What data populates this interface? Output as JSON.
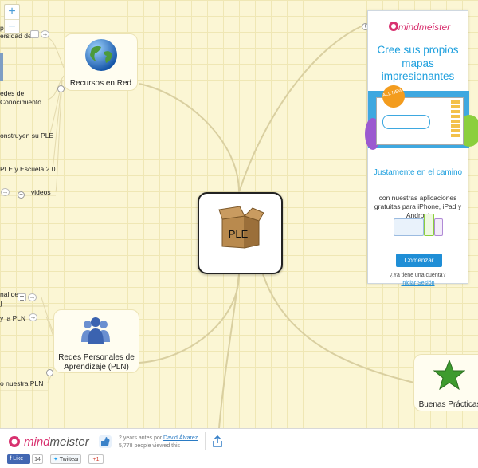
{
  "zoom": {
    "in": "+",
    "out": "−"
  },
  "left_nodes": [
    {
      "text": "p"
    },
    {
      "text": "ersidad de"
    },
    {
      "text": "edes de"
    },
    {
      "text": "Conocimiento"
    },
    {
      "text": "onstruyen su PLE"
    },
    {
      "text": "PLE y Escuela 2.0"
    },
    {
      "text": "videos"
    },
    {
      "text": "nal de"
    },
    {
      "text": "]"
    },
    {
      "text": "y la PLN"
    },
    {
      "text": "o nuestra PLN"
    }
  ],
  "topics": {
    "recursos": "Recursos en Red",
    "redes": "Redes Personales de Aprendizaje (PLN)",
    "buenas": "Buenas Prácticas"
  },
  "central": {
    "label": "PLE"
  },
  "ad": {
    "brand": "mindmeister",
    "headline": "Cree sus propios mapas impresionantes",
    "badge": "ALL NEW",
    "sub": "Justamente en el camino",
    "desc": "con nuestras aplicaciones gratuitas para iPhone, iPad y Android",
    "cta": "Comenzar",
    "question": "¿Ya tiene una cuenta?",
    "login": "Iniciar Sesión"
  },
  "footer": {
    "brand_mind": "mind",
    "brand_meister": "meister",
    "time": "2 years antes por",
    "author": "David Álvarez",
    "views": "5,778 people viewed this",
    "fb_label": "Like",
    "fb_count": "14",
    "tw_label": "Twittear",
    "gp_label": "+1"
  },
  "colors": {
    "canvas": "#fbf6d4",
    "branch": "#d9cfa0",
    "accent": "#1fa0de",
    "brand": "#d8316f"
  }
}
